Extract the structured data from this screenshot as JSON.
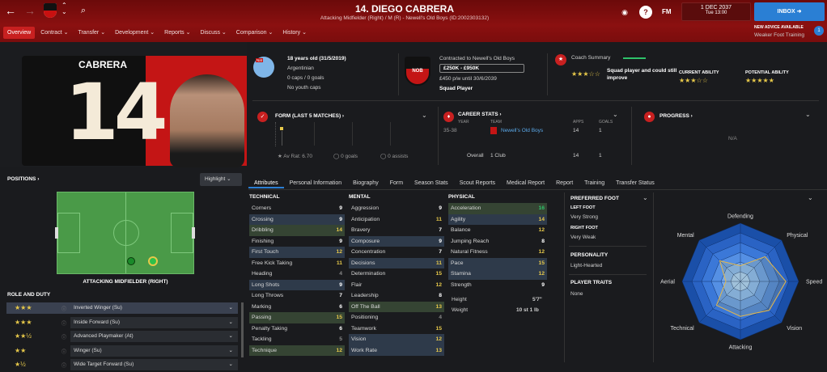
{
  "header": {
    "title": "14. DIEGO CABRERA",
    "subtitle": "Attacking Midfielder (Right) / M (R) - Newell's Old Boys (ID:2002303132)",
    "date": "1 DEC 2037",
    "time": "Tue 13:00",
    "inbox": "INBOX",
    "fm": "FM",
    "advice_title": "NEW ADVICE AVAILABLE",
    "advice_text": "Weaker Foot Training",
    "advice_count": "1",
    "club_badge": "NOB"
  },
  "menu": [
    "Overview",
    "Contract",
    "Transfer",
    "Development",
    "Reports",
    "Discuss",
    "Comparison",
    "History"
  ],
  "hero": {
    "surname": "CABRERA",
    "number": "14"
  },
  "bio": {
    "age": "18 years old (31/5/2019)",
    "nationality": "Argentinian",
    "caps": "0 caps / 0 goals",
    "youth": "No youth caps",
    "nat_badge": "Nat"
  },
  "contract": {
    "line": "Contracted to Newell's Old Boys",
    "value": "£250K - £950K",
    "wage": "£450 p/w until 30/6/2039",
    "status": "Squad Player"
  },
  "coach": {
    "title": "Coach Summary",
    "summary": "Squad player and could still improve",
    "ca_label": "CURRENT ABILITY",
    "pa_label": "POTENTIAL ABILITY",
    "stars_summary": "★★★☆☆",
    "stars_ca": "★★★☆☆",
    "stars_pa": "★★★★★"
  },
  "form": {
    "title": "FORM (LAST 5 MATCHES)",
    "av_rat": "Av Rat: 6.70",
    "goals": "0 goals",
    "assists": "0 assists"
  },
  "career": {
    "title": "CAREER STATS",
    "year_h": "YEAR",
    "team_h": "TEAM",
    "apps_h": "APPS",
    "goals_h": "GOALS",
    "year": "35-38",
    "team": "Newell's Old Boys",
    "apps": "14",
    "goals": "1",
    "overall": "Overall",
    "clubs": "1 Club",
    "o_apps": "14",
    "o_goals": "1"
  },
  "progress": {
    "title": "PROGRESS",
    "value": "N/A"
  },
  "positions": {
    "title": "POSITIONS",
    "highlight": "Highlight",
    "pos_label": "ATTACKING MIDFIELDER (RIGHT)"
  },
  "roles": {
    "title": "ROLE AND DUTY",
    "items": [
      {
        "stars": "★★★",
        "name": "Inverted Winger (Su)"
      },
      {
        "stars": "★★★",
        "name": "Inside Forward (Su)"
      },
      {
        "stars": "★★½",
        "name": "Advanced Playmaker (At)"
      },
      {
        "stars": "★★",
        "name": "Winger (Su)"
      },
      {
        "stars": "★½",
        "name": "Wide Target Forward (Su)"
      }
    ]
  },
  "tabs": [
    "Attributes",
    "Personal Information",
    "Biography",
    "Form",
    "Season Stats",
    "Scout Reports",
    "Medical Report",
    "Report",
    "Training",
    "Transfer Status"
  ],
  "technical": {
    "title": "TECHNICAL",
    "rows": [
      [
        "Corners",
        "9",
        ""
      ],
      [
        "Crossing",
        "9",
        "hl"
      ],
      [
        "Dribbling",
        "14",
        "hg"
      ],
      [
        "Finishing",
        "9",
        ""
      ],
      [
        "First Touch",
        "12",
        "hl"
      ],
      [
        "Free Kick Taking",
        "11",
        ""
      ],
      [
        "Heading",
        "4",
        ""
      ],
      [
        "Long Shots",
        "9",
        "hl"
      ],
      [
        "Long Throws",
        "7",
        ""
      ],
      [
        "Marking",
        "6",
        ""
      ],
      [
        "Passing",
        "15",
        "hg"
      ],
      [
        "Penalty Taking",
        "6",
        ""
      ],
      [
        "Tackling",
        "5",
        ""
      ],
      [
        "Technique",
        "12",
        "hg"
      ]
    ]
  },
  "mental": {
    "title": "MENTAL",
    "rows": [
      [
        "Aggression",
        "9",
        ""
      ],
      [
        "Anticipation",
        "11",
        ""
      ],
      [
        "Bravery",
        "7",
        ""
      ],
      [
        "Composure",
        "9",
        "hl"
      ],
      [
        "Concentration",
        "7",
        ""
      ],
      [
        "Decisions",
        "11",
        "hl"
      ],
      [
        "Determination",
        "15",
        ""
      ],
      [
        "Flair",
        "12",
        ""
      ],
      [
        "Leadership",
        "8",
        ""
      ],
      [
        "Off The Ball",
        "13",
        "hg"
      ],
      [
        "Positioning",
        "4",
        ""
      ],
      [
        "Teamwork",
        "15",
        ""
      ],
      [
        "Vision",
        "12",
        "hl"
      ],
      [
        "Work Rate",
        "13",
        "hl"
      ]
    ]
  },
  "physical": {
    "title": "PHYSICAL",
    "rows": [
      [
        "Acceleration",
        "16",
        "hg"
      ],
      [
        "Agility",
        "14",
        "hl"
      ],
      [
        "Balance",
        "12",
        ""
      ],
      [
        "Jumping Reach",
        "8",
        ""
      ],
      [
        "Natural Fitness",
        "12",
        ""
      ],
      [
        "Pace",
        "15",
        "hl"
      ],
      [
        "Stamina",
        "12",
        "hl"
      ],
      [
        "Strength",
        "9",
        ""
      ]
    ],
    "height_l": "Height",
    "height": "5'7\"",
    "weight_l": "Weight",
    "weight": "10 st 1 lb"
  },
  "foot": {
    "title": "PREFERRED FOOT",
    "left_l": "LEFT FOOT",
    "left": "Very Strong",
    "right_l": "RIGHT FOOT",
    "right": "Very Weak"
  },
  "personality": {
    "title": "PERSONALITY",
    "value": "Light-Hearted"
  },
  "traits": {
    "title": "PLAYER TRAITS",
    "value": "None"
  },
  "radar": {
    "labels": [
      "Defending",
      "Physical",
      "Speed",
      "Vision",
      "Attacking",
      "Technical",
      "Aerial",
      "Mental"
    ],
    "values": [
      0.27,
      0.6,
      0.78,
      0.7,
      0.6,
      0.58,
      0.25,
      0.5
    ]
  }
}
